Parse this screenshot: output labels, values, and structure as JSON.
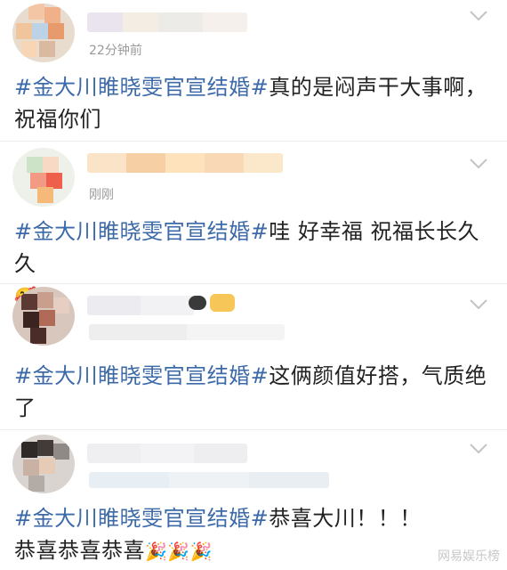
{
  "posts": [
    {
      "time": "22分钟前",
      "hashtag": "#金大川睢晓雯官宣结婚#",
      "text": "真的是闷声干大事啊，祝福你们",
      "emoji": ""
    },
    {
      "time": "刚刚",
      "hashtag": "#金大川睢晓雯官宣结婚#",
      "text": "哇 好幸福 祝福长长久久",
      "emoji": "🥰"
    },
    {
      "time": "",
      "hashtag": "#金大川睢晓雯官宣结婚#",
      "text": "这俩颜值好搭，气质绝了",
      "emoji": ""
    },
    {
      "time": "",
      "hashtag": "#金大川睢晓雯官宣结婚#",
      "text": "恭喜大川！！！",
      "text2": "恭喜恭喜恭喜",
      "emoji": "🎉🎉🎉"
    }
  ],
  "watermark": "网易娱乐榜",
  "icons": {
    "expand": "chevron-down-icon",
    "avatar": "avatar"
  }
}
